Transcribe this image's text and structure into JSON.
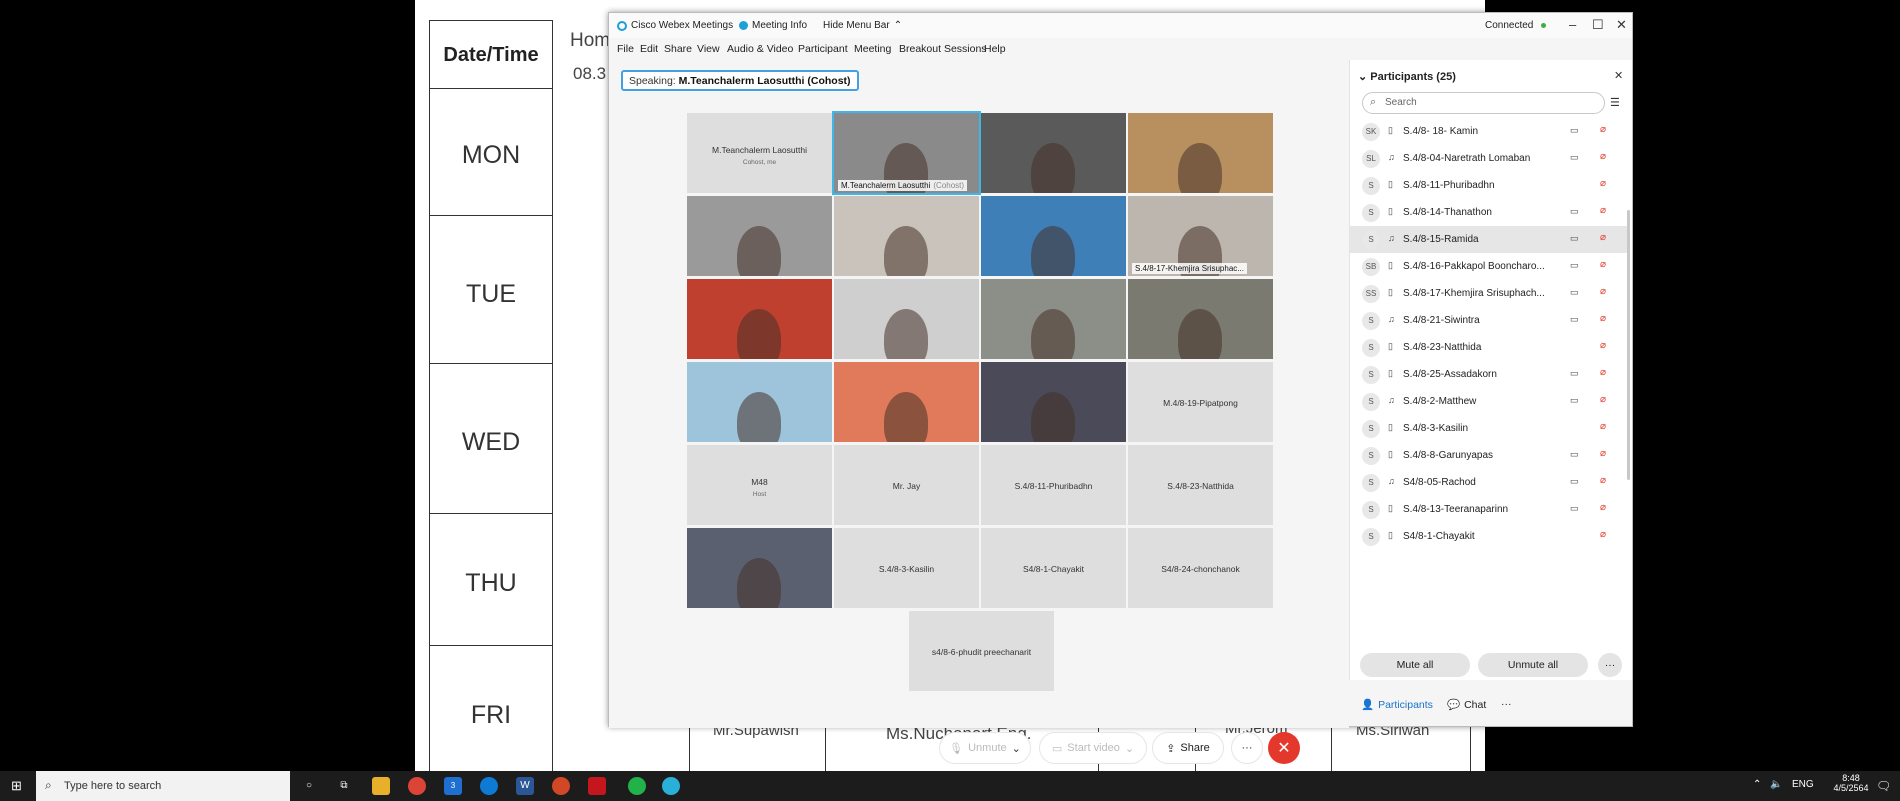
{
  "document": {
    "header_date": "Date/Time",
    "header_home": "Hom",
    "header_time": "08.3",
    "days": [
      "MON",
      "TUE",
      "WED",
      "THU",
      "FRI"
    ],
    "teachers": [
      "Mr.Supawish",
      "Ms.Nuchanart Eng.",
      "Mr.Jerom",
      "Ms.Siriwan"
    ]
  },
  "window": {
    "app_title": "Cisco Webex Meetings",
    "meeting_info": "Meeting Info",
    "hide_menu": "Hide Menu Bar",
    "status": "Connected"
  },
  "menu": [
    "File",
    "Edit",
    "Share",
    "View",
    "Audio & Video",
    "Participant",
    "Meeting",
    "Breakout Sessions",
    "Help"
  ],
  "speaking": {
    "label": "Speaking:",
    "name": "M.Teanchalerm Laosutthi (Cohost)"
  },
  "tiles": [
    {
      "name": "M.Teanchalerm Laosutthi",
      "sub": "Cohost, me",
      "video": false
    },
    {
      "name": "M.Teanchalerm Laosutthi",
      "tag": "(Cohost)",
      "video": true
    },
    {
      "name": "",
      "video": true
    },
    {
      "name": "",
      "video": true
    },
    {
      "name": "",
      "video": true
    },
    {
      "name": "",
      "video": true
    },
    {
      "name": "",
      "video": true
    },
    {
      "name": "S.4/8-17-Khemjira Srisuphac...",
      "video": true
    },
    {
      "name": "",
      "video": true
    },
    {
      "name": "",
      "video": true
    },
    {
      "name": "",
      "video": true
    },
    {
      "name": "",
      "video": true
    },
    {
      "name": "",
      "video": true
    },
    {
      "name": "",
      "video": true
    },
    {
      "name": "",
      "video": true
    },
    {
      "name": "M.4/8-19-Pipatpong",
      "video": false
    },
    {
      "name": "M48",
      "sub": "Host",
      "video": false
    },
    {
      "name": "Mr. Jay",
      "video": false
    },
    {
      "name": "S.4/8-11-Phuribadhn",
      "video": false
    },
    {
      "name": "S.4/8-23-Natthida",
      "video": false
    },
    {
      "name": "",
      "video": true
    },
    {
      "name": "S.4/8-3-Kasilin",
      "video": false
    },
    {
      "name": "S4/8-1-Chayakit",
      "video": false
    },
    {
      "name": "S4/8-24-chonchanok",
      "video": false
    },
    {
      "name": "s4/8-6-phudit preechanarit",
      "video": false
    }
  ],
  "controls": {
    "unmute": "Unmute",
    "start_video": "Start video",
    "share": "Share"
  },
  "panel": {
    "title": "Participants (25)",
    "search_placeholder": "Search",
    "participants": [
      {
        "initials": "SK",
        "name": "S.4/8- 18- Kamin"
      },
      {
        "initials": "SL",
        "name": "S.4/8-04-Naretrath Lomaban"
      },
      {
        "initials": "S",
        "name": "S.4/8-11-Phuribadhn"
      },
      {
        "initials": "S",
        "name": "S.4/8-14-Thanathon"
      },
      {
        "initials": "S",
        "name": "S.4/8-15-Ramida"
      },
      {
        "initials": "SB",
        "name": "S.4/8-16-Pakkapol Booncharo..."
      },
      {
        "initials": "SS",
        "name": "S.4/8-17-Khemjira Srisuphach..."
      },
      {
        "initials": "S",
        "name": "S.4/8-21-Siwintra"
      },
      {
        "initials": "S",
        "name": "S.4/8-23-Natthida"
      },
      {
        "initials": "S",
        "name": "S.4/8-25-Assadakorn"
      },
      {
        "initials": "S",
        "name": "S.4/8-2-Matthew"
      },
      {
        "initials": "S",
        "name": "S.4/8-3-Kasilin"
      },
      {
        "initials": "S",
        "name": "S.4/8-8-Garunyapas"
      },
      {
        "initials": "S",
        "name": "S4/8-05-Rachod"
      },
      {
        "initials": "S",
        "name": "S.4/8-13-Teeranaparinn"
      },
      {
        "initials": "S",
        "name": "S4/8-1-Chayakit"
      }
    ],
    "mute_all": "Mute all",
    "unmute_all": "Unmute all"
  },
  "tabs": {
    "participants": "Participants",
    "chat": "Chat"
  },
  "taskbar": {
    "search": "Type here to search",
    "lang": "ENG",
    "time": "8:48",
    "date": "4/5/2564",
    "badge": "3"
  }
}
